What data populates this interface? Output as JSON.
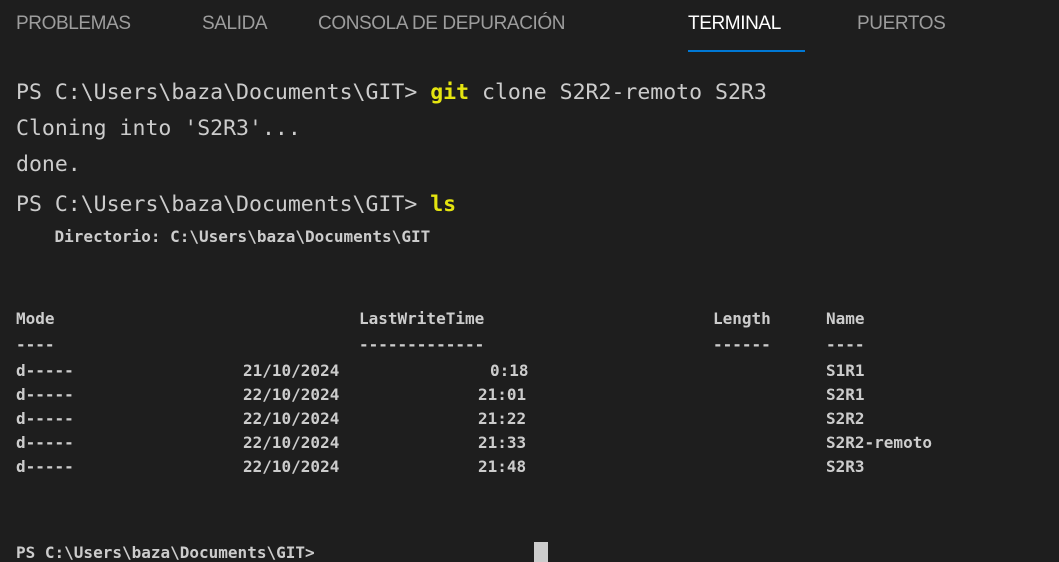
{
  "panel": {
    "tabs": [
      {
        "label": "PROBLEMAS",
        "active": false
      },
      {
        "label": "SALIDA",
        "active": false
      },
      {
        "label": "CONSOLA DE DEPURACIÓN",
        "active": false
      },
      {
        "label": "TERMINAL",
        "active": true
      },
      {
        "label": "PUERTOS",
        "active": false
      }
    ]
  },
  "terminal": {
    "prompt": "PS C:\\Users\\baza\\Documents\\GIT> ",
    "command1": {
      "keyword": "git",
      "args": " clone S2R2-remoto S2R3"
    },
    "output1": "Cloning into 'S2R3'...",
    "output2": "done.",
    "command2": {
      "keyword": "ls"
    },
    "directory_line": "    Directorio: C:\\Users\\baza\\Documents\\GIT",
    "table": {
      "headers": {
        "mode": "Mode",
        "lastwritetime": "LastWriteTime",
        "length": "Length",
        "name": "Name"
      },
      "underlines": {
        "mode": "----",
        "lastwritetime": "-------------",
        "length": "------",
        "name": "----"
      },
      "rows": [
        {
          "mode": "d-----",
          "date": "21/10/2024",
          "time": "0:18",
          "length": "",
          "name": "S1R1"
        },
        {
          "mode": "d-----",
          "date": "22/10/2024",
          "time": "21:01",
          "length": "",
          "name": "S2R1"
        },
        {
          "mode": "d-----",
          "date": "22/10/2024",
          "time": "21:22",
          "length": "",
          "name": "S2R2"
        },
        {
          "mode": "d-----",
          "date": "22/10/2024",
          "time": "21:33",
          "length": "",
          "name": "S2R2-remoto"
        },
        {
          "mode": "d-----",
          "date": "22/10/2024",
          "time": "21:48",
          "length": "",
          "name": "S2R3"
        }
      ]
    },
    "final_prompt": "PS C:\\Users\\baza\\Documents\\GIT> "
  },
  "colors": {
    "background": "#1e1e1e",
    "text": "#cccccc",
    "command": "#e5e510",
    "active_tab_underline": "#0078d4",
    "inactive_tab": "#9d9d9d"
  }
}
